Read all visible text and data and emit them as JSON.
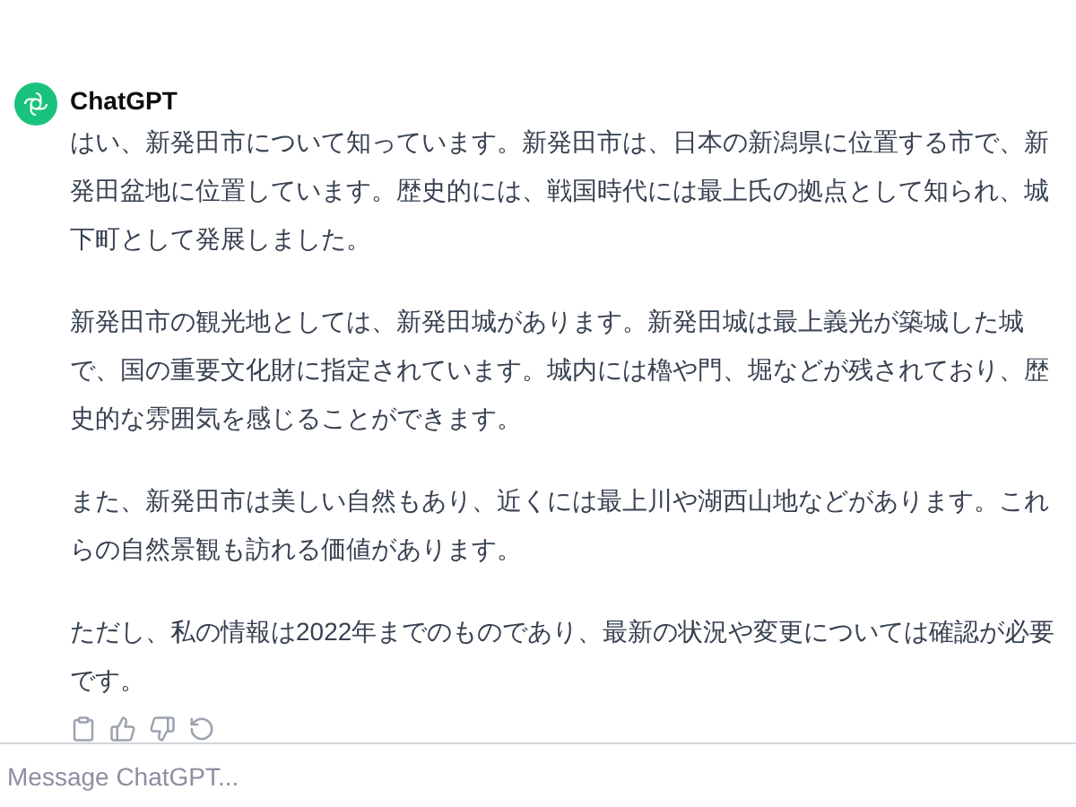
{
  "message": {
    "author": "ChatGPT",
    "paragraphs": [
      "はい、新発田市について知っています。新発田市は、日本の新潟県に位置する市で、新発田盆地に位置しています。歴史的には、戦国時代には最上氏の拠点として知られ、城下町として発展しました。",
      "新発田市の観光地としては、新発田城があります。新発田城は最上義光が築城した城で、国の重要文化財に指定されています。城内には櫓や門、堀などが残されており、歴史的な雰囲気を感じることができます。",
      "また、新発田市は美しい自然もあり、近くには最上川や湖西山地などがあります。これらの自然景観も訪れる価値があります。",
      "ただし、私の情報は2022年までのものであり、最新の状況や変更については確認が必要です。"
    ]
  },
  "composer": {
    "placeholder": "Message ChatGPT..."
  }
}
